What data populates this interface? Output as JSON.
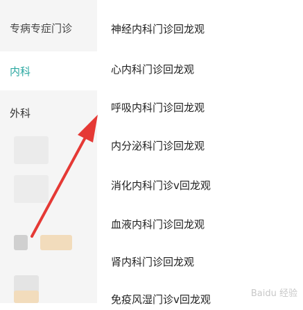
{
  "left_menu": {
    "items": [
      {
        "label": "专病专症门诊"
      },
      {
        "label": "内科"
      },
      {
        "label": "外科"
      }
    ]
  },
  "right_list": {
    "items": [
      {
        "label": "神经内科门诊回龙观"
      },
      {
        "label": "心内科门诊回龙观"
      },
      {
        "label": "呼吸内科门诊回龙观"
      },
      {
        "label": "内分泌科门诊回龙观"
      },
      {
        "label": "消化内科门诊v回龙观"
      },
      {
        "label": "血液内科门诊回龙观"
      },
      {
        "label": "肾内科门诊回龙观"
      },
      {
        "label": "免疫风湿门诊v回龙观"
      }
    ]
  },
  "watermark": {
    "text": "Baidu 经验"
  },
  "colors": {
    "accent": "#2aa7a0",
    "arrow": "#e53935"
  }
}
